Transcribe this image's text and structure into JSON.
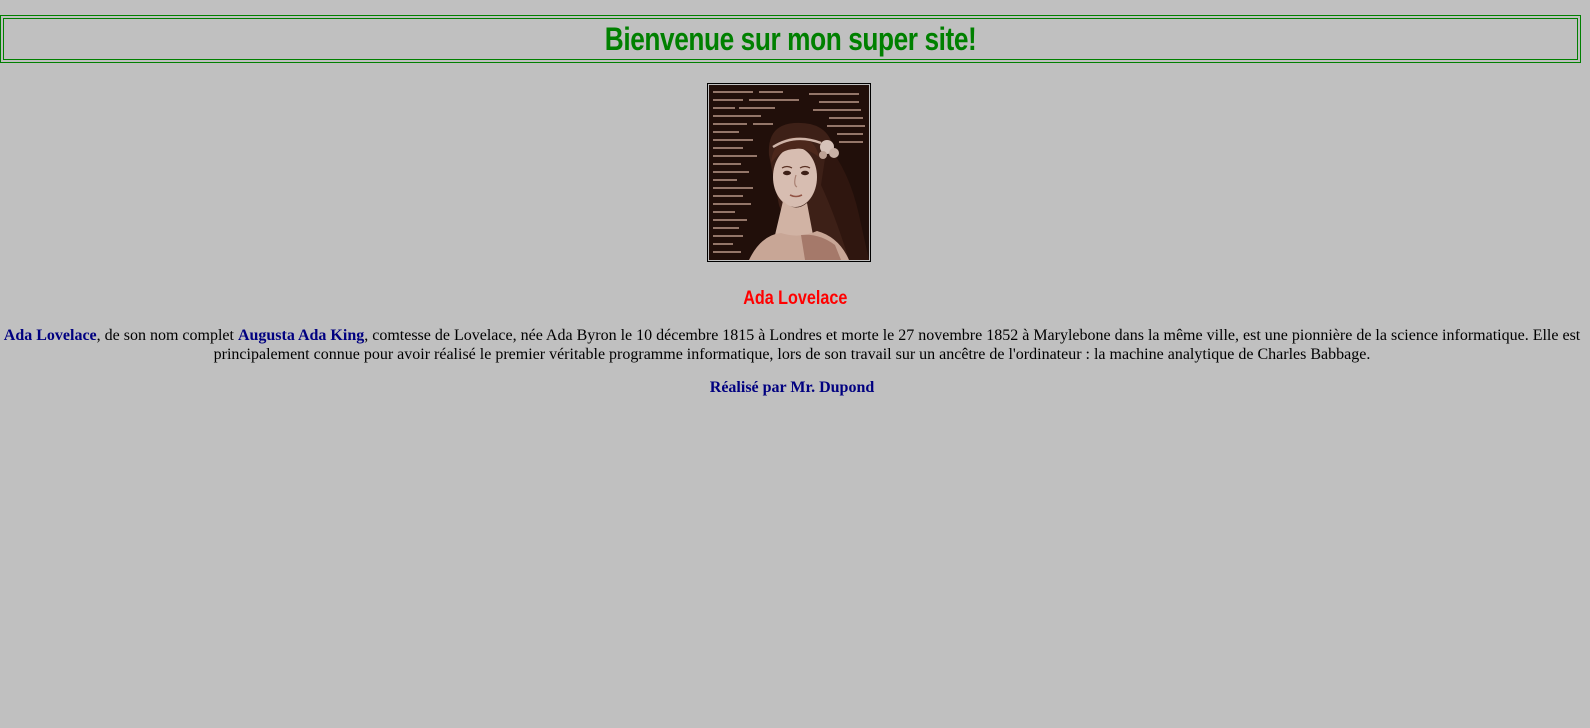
{
  "header": {
    "title": "Bienvenue sur mon super site!"
  },
  "portrait": {
    "subject": "Ada Lovelace portrait over code background",
    "icon": "portrait-image"
  },
  "section": {
    "heading": "Ada Lovelace"
  },
  "bio": {
    "name1": "Ada Lovelace",
    "text1": ", de son nom complet ",
    "name2": "Augusta Ada King",
    "text2": ", comtesse de Lovelace, née Ada Byron le 10 décembre 1815 à Londres et morte le 27 novembre 1852 à Marylebone dans la même ville, est une pionnière de la science informatique. Elle est principalement connue pour avoir réalisé le premier véritable programme informatique, lors de son travail sur un ancêtre de l'ordinateur : la machine analytique de Charles Babbage."
  },
  "footer": {
    "credit": "Réalisé par Mr. Dupond"
  },
  "colors": {
    "background": "#c0c0c0",
    "title": "#008000",
    "heading": "#ff0000",
    "names": "#000080"
  }
}
